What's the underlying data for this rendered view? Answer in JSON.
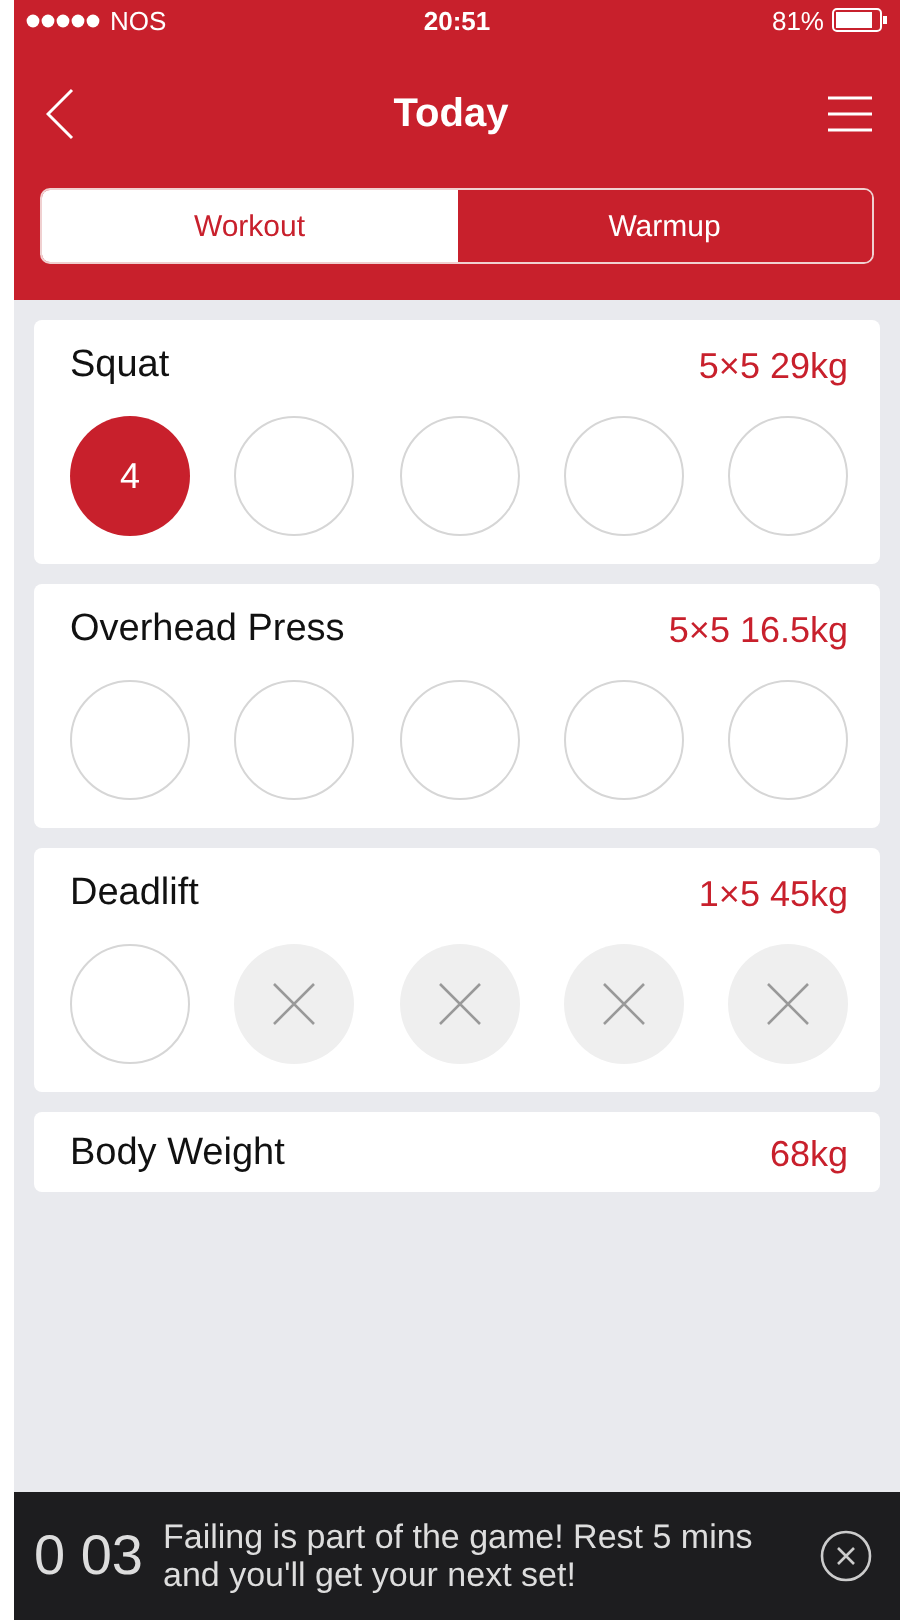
{
  "status_bar": {
    "carrier": "NOS",
    "time": "20:51",
    "battery": "81%"
  },
  "nav": {
    "title": "Today"
  },
  "tabs": [
    {
      "label": "Workout",
      "selected": true
    },
    {
      "label": "Warmup",
      "selected": false
    }
  ],
  "exercises": [
    {
      "name": "Squat",
      "scheme": "5×5 29kg",
      "sets": [
        {
          "kind": "done",
          "reps": "4"
        },
        {
          "kind": "empty"
        },
        {
          "kind": "empty"
        },
        {
          "kind": "empty"
        },
        {
          "kind": "empty"
        }
      ]
    },
    {
      "name": "Overhead Press",
      "scheme": "5×5 16.5kg",
      "sets": [
        {
          "kind": "empty"
        },
        {
          "kind": "empty"
        },
        {
          "kind": "empty"
        },
        {
          "kind": "empty"
        },
        {
          "kind": "empty"
        }
      ]
    },
    {
      "name": "Deadlift",
      "scheme": "1×5 45kg",
      "sets": [
        {
          "kind": "empty"
        },
        {
          "kind": "skipped"
        },
        {
          "kind": "skipped"
        },
        {
          "kind": "skipped"
        },
        {
          "kind": "skipped"
        }
      ]
    }
  ],
  "body_weight": {
    "label": "Body Weight",
    "value": "68kg"
  },
  "timer": {
    "time": "0 03",
    "message": "Failing is part of the game! Rest 5 mins and you'll get your next set!"
  }
}
